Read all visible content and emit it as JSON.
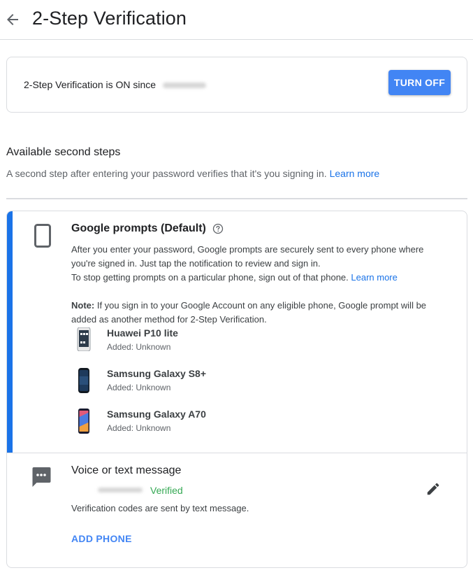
{
  "header": {
    "title": "2-Step Verification",
    "back_icon": "arrow-back-icon"
  },
  "status": {
    "text": "2-Step Verification is ON since",
    "turn_off_label": "TURN OFF"
  },
  "available": {
    "title": "Available second steps",
    "description": "A second step after entering your password verifies that it's you signing in.",
    "learn_more": "Learn more"
  },
  "google_prompts": {
    "title": "Google prompts (Default)",
    "icon": "smartphone-icon",
    "help_icon": "help-circle-icon",
    "desc_line1": "After you enter your password, Google prompts are securely sent to every phone where you're signed in. Just tap the notification to review and sign in.",
    "desc_line2": "To stop getting prompts on a particular phone, sign out of that phone.",
    "learn_more": "Learn more",
    "note_label": "Note:",
    "note_text": "If you sign in to your Google Account on any eligible phone, Google prompt will be added as another method for 2-Step Verification.",
    "devices": [
      {
        "name": "Huawei P10 lite",
        "added": "Added: Unknown"
      },
      {
        "name": "Samsung Galaxy S8+",
        "added": "Added: Unknown"
      },
      {
        "name": "Samsung Galaxy A70",
        "added": "Added: Unknown"
      }
    ]
  },
  "voice_sms": {
    "title": "Voice or text message",
    "icon": "sms-icon",
    "status": "Verified",
    "edit_icon": "pencil-icon",
    "description": "Verification codes are sent by text message.",
    "add_phone": "ADD PHONE"
  },
  "colors": {
    "accent": "#1a73e8",
    "button": "#4285f4",
    "verified": "#34a853"
  }
}
